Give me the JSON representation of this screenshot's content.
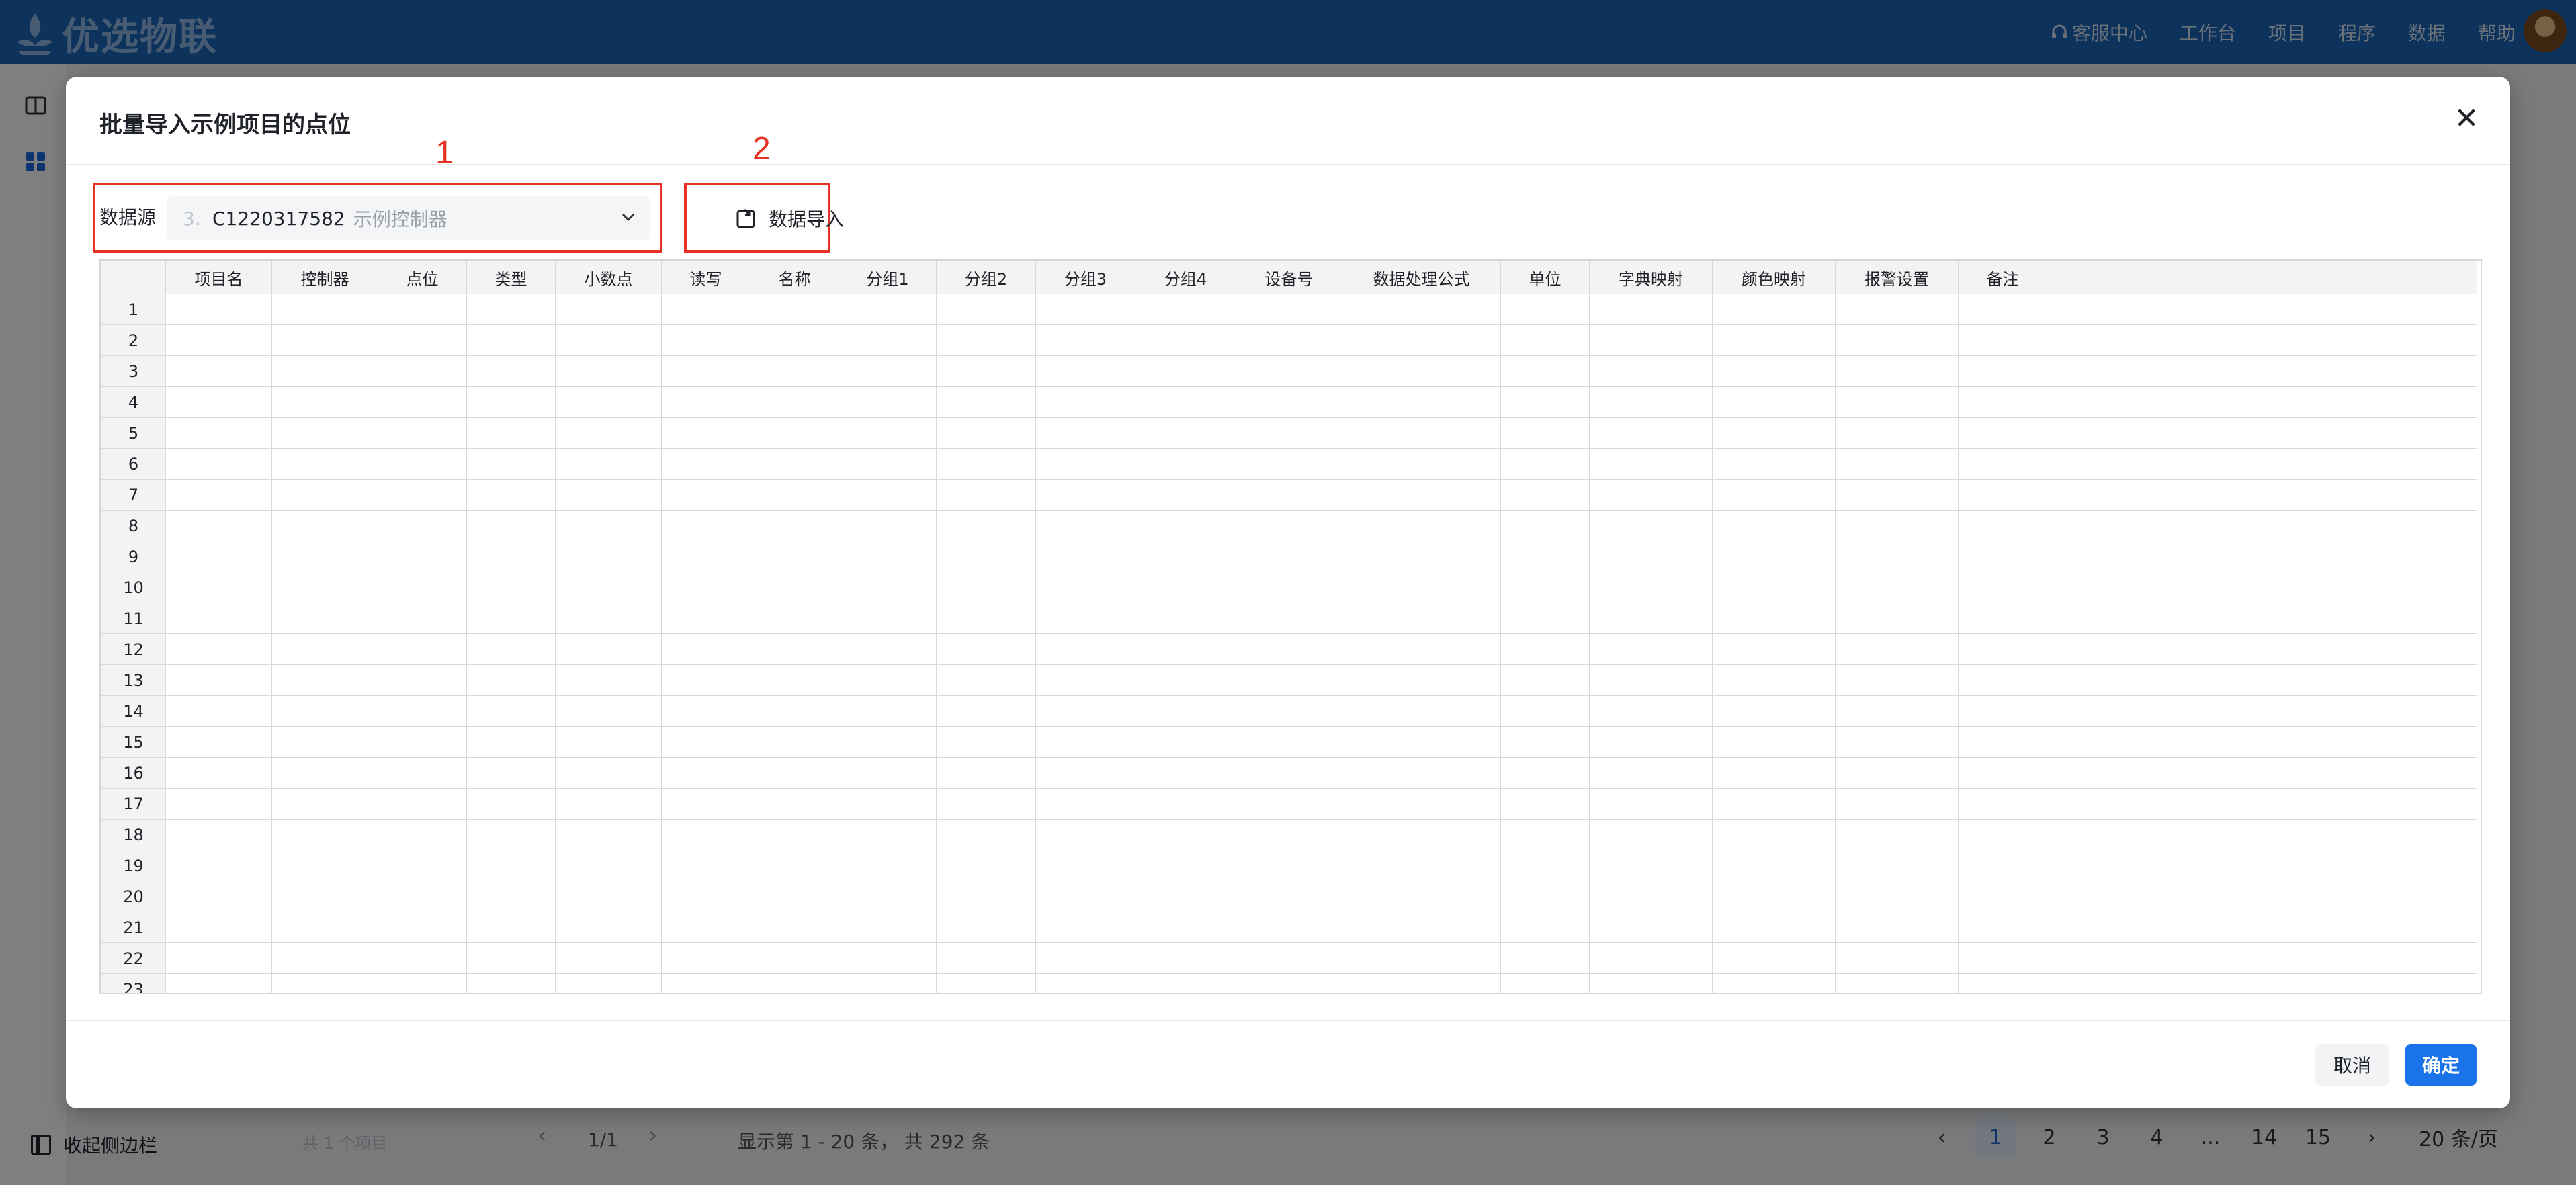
{
  "header": {
    "logo_text": "优选物联",
    "nav": [
      {
        "label": "客服中心",
        "icon": "headset-icon"
      },
      {
        "label": "工作台"
      },
      {
        "label": "项目"
      },
      {
        "label": "程序"
      },
      {
        "label": "数据"
      },
      {
        "label": "帮助"
      }
    ]
  },
  "background": {
    "sidebar_collapse_label": "收起侧边栏",
    "project_count": "共 1 个项目",
    "project_page": "1/1",
    "total_text": "显示第 1 - 20 条， 共 292 条",
    "pages": [
      "1",
      "2",
      "3",
      "4",
      "...",
      "14",
      "15"
    ],
    "active_page": "1",
    "page_size": "20 条/页"
  },
  "modal": {
    "title": "批量导入示例项目的点位",
    "annotation_1": "1",
    "annotation_2": "2",
    "datasource_label": "数据源",
    "datasource_index": "3.",
    "datasource_code": "C1220317582",
    "datasource_desc": "示例控制器",
    "import_button": "数据导入",
    "cancel_button": "取消",
    "confirm_button": "确定",
    "table": {
      "columns": [
        "项目名",
        "控制器",
        "点位",
        "类型",
        "小数点",
        "读写",
        "名称",
        "分组1",
        "分组2",
        "分组3",
        "分组4",
        "设备号",
        "数据处理公式",
        "单位",
        "字典映射",
        "颜色映射",
        "报警设置",
        "备注",
        ""
      ],
      "rows": [
        "1",
        "2",
        "3",
        "4",
        "5",
        "6",
        "7",
        "8",
        "9",
        "10",
        "11",
        "12",
        "13",
        "14",
        "15",
        "16",
        "17",
        "18",
        "19",
        "20",
        "21",
        "22",
        "23"
      ]
    }
  },
  "colors": {
    "header_bg": "#1a66b8",
    "primary": "#1a73e8",
    "annotation": "#e53224"
  }
}
